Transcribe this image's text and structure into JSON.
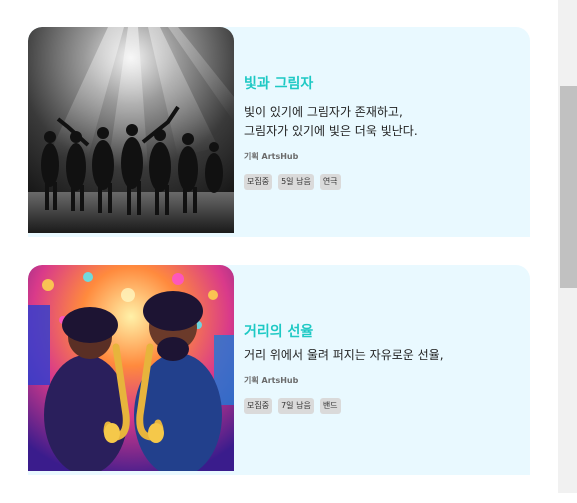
{
  "cards": [
    {
      "title": "빛과 그림자",
      "description": "빛이 있기에 그림자가 존재하고,\n그림자가 있기에 빛은 더욱 빛난다.",
      "organizer": "기획 ArtsHub",
      "tags": [
        "모집중",
        "5일 남음",
        "연극"
      ],
      "image": "black-and-white-dancers-under-stage-spotlights"
    },
    {
      "title": "거리의 선율",
      "description": "거리 위에서 울려 퍼지는 자유로운 선율,",
      "organizer": "기획 ArtsHub",
      "tags": [
        "모집중",
        "7일 남음",
        "밴드"
      ],
      "image": "colorful-illustration-two-saxophone-players"
    }
  ],
  "colors": {
    "card_bg": "#e9f9ff",
    "title": "#1ec9c4",
    "tag_bg": "#dadada"
  }
}
